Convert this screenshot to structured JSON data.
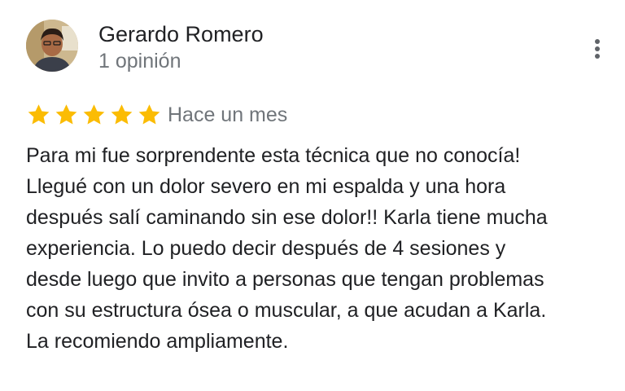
{
  "review": {
    "reviewer_name": "Gerardo Romero",
    "review_count": "1 opinión",
    "avatar_icon": "reviewer-photo",
    "rating": 5,
    "rating_max": 5,
    "time_ago": "Hace un mes",
    "text": "Para mi fue sorprendente esta técnica que no conocía!\nLlegué con un dolor severo en mi espalda y una hora\ndespués salí caminando sin ese dolor!! Karla tiene mucha\nexperiencia. Lo puedo decir después de 4 sesiones y\ndesde luego que invito a personas que tengan problemas\ncon su estructura ósea o muscular, a que acudan a Karla.\nLa recomiendo ampliamente.",
    "menu_icon": "more-vert-icon"
  },
  "colors": {
    "star": "#fbbc04",
    "secondary_text": "#70757a",
    "primary_text": "#202124",
    "menu_dots": "#5f6368"
  }
}
